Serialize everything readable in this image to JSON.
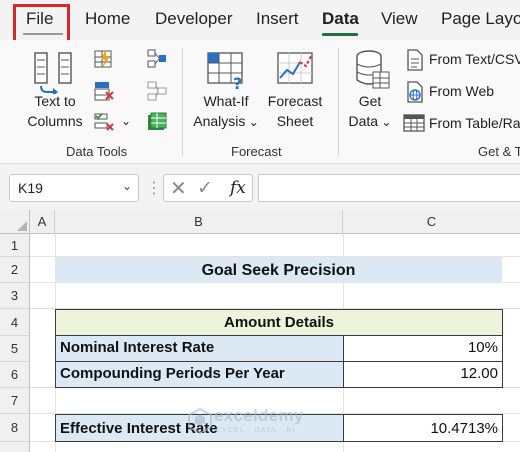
{
  "menu": {
    "tabs": [
      {
        "label": "File"
      },
      {
        "label": "Home"
      },
      {
        "label": "Developer"
      },
      {
        "label": "Insert"
      },
      {
        "label": "Data"
      },
      {
        "label": "View"
      },
      {
        "label": "Page Layout"
      }
    ],
    "active_tab": "Data",
    "highlighted_tab": "File",
    "highlight_color": "#d42a2a",
    "accent_color": "#1f7145"
  },
  "ribbon": {
    "groups": {
      "data_tools": {
        "label": "Data Tools",
        "text_to_columns": {
          "line1": "Text to",
          "line2": "Columns",
          "icon": "text-to-columns-icon"
        },
        "small_icons": [
          "flash-fill-icon",
          "remove-duplicates-icon",
          "data-validation-icon",
          "consolidate-icon",
          "relationships-icon",
          "manage-data-model-icon"
        ]
      },
      "forecast": {
        "label": "Forecast",
        "what_if": {
          "line1": "What-If",
          "line2": "Analysis",
          "icon": "what-if-analysis-icon"
        },
        "forecast_sheet": {
          "line1": "Forecast",
          "line2": "Sheet",
          "icon": "forecast-sheet-icon"
        }
      },
      "get_transform": {
        "label": "Get & T",
        "get_data": {
          "line1": "Get",
          "line2": "Data",
          "icon": "database-icon"
        },
        "from_text_csv": "From Text/CSV",
        "from_web": "From Web",
        "from_table": "From Table/Ra"
      }
    }
  },
  "formula_bar": {
    "name_box": "K19",
    "formula": ""
  },
  "grid": {
    "columns": [
      "A",
      "B",
      "C"
    ],
    "rows": [
      "1",
      "2",
      "3",
      "4",
      "5",
      "6",
      "7",
      "8"
    ]
  },
  "sheet": {
    "title": "Goal Seek Precision",
    "table_header": "Amount Details",
    "rows": [
      {
        "label": "Nominal Interest Rate",
        "value": "10%"
      },
      {
        "label": "Compounding Periods Per Year",
        "value": "12.00"
      }
    ],
    "result": {
      "label": "Effective Interest Rate",
      "value": "10.4713%"
    },
    "colors": {
      "label_fill": "#dbe9f4",
      "header_fill": "#eef3dc",
      "title_fill": "#dbe9f4"
    }
  },
  "watermark": {
    "name": "exceldemy",
    "tagline": "EXCEL · DATA · BI"
  }
}
